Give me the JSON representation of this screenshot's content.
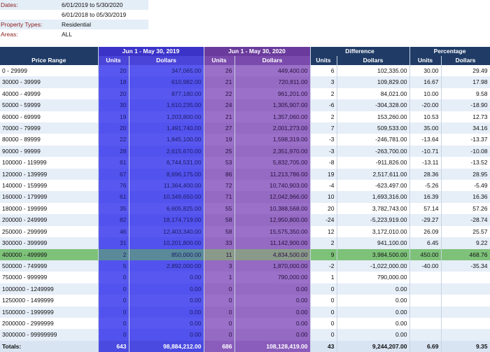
{
  "filters": [
    {
      "label": "Dates:",
      "value": "6/01/2019 to 5/30/2020"
    },
    {
      "label": "",
      "value": "6/01/2018 to 05/30/2019"
    },
    {
      "label": "Property Types:",
      "value": "Residential"
    },
    {
      "label": "Areas:",
      "value": "ALL"
    }
  ],
  "header": {
    "period1": "Jun 1 - May 30, 2019",
    "period2": "Jun 1 - May 30, 2020",
    "difference": "Difference",
    "percentage": "Percentage",
    "price_range": "Price Range",
    "units": "Units",
    "dollars": "Dollars"
  },
  "rows": [
    [
      "0 - 29999",
      "20",
      "347,065.00",
      "26",
      "449,400.00",
      "6",
      "102,335.00",
      "30.00",
      "29.49"
    ],
    [
      "30000 - 39999",
      "18",
      "610,982.00",
      "21",
      "720,811.00",
      "3",
      "109,829.00",
      "16.67",
      "17.98"
    ],
    [
      "40000 - 49999",
      "20",
      "877,180.00",
      "22",
      "961,201.00",
      "2",
      "84,021.00",
      "10.00",
      "9.58"
    ],
    [
      "50000 - 59999",
      "30",
      "1,610,235.00",
      "24",
      "1,305,907.00",
      "-6",
      "-304,328.00",
      "-20.00",
      "-18.90"
    ],
    [
      "60000 - 69999",
      "19",
      "1,203,800.00",
      "21",
      "1,357,060.00",
      "2",
      "153,260.00",
      "10.53",
      "12.73"
    ],
    [
      "70000 - 79999",
      "20",
      "1,491,740.00",
      "27",
      "2,001,273.00",
      "7",
      "509,533.00",
      "35.00",
      "34.16"
    ],
    [
      "80000 - 89999",
      "22",
      "1,845,100.00",
      "19",
      "1,598,319.00",
      "-3",
      "-246,781.00",
      "-13.64",
      "-13.37"
    ],
    [
      "90000 - 99999",
      "28",
      "2,615,670.00",
      "25",
      "2,351,970.00",
      "-3",
      "-263,700.00",
      "-10.71",
      "-10.08"
    ],
    [
      "100000 - 119999",
      "61",
      "6,744,531.00",
      "53",
      "5,832,705.00",
      "-8",
      "-911,826.00",
      "-13.11",
      "-13.52"
    ],
    [
      "120000 - 139999",
      "67",
      "8,696,175.00",
      "86",
      "11,213,786.00",
      "19",
      "2,517,611.00",
      "28.36",
      "28.95"
    ],
    [
      "140000 - 159999",
      "76",
      "11,364,400.00",
      "72",
      "10,740,903.00",
      "-4",
      "-623,497.00",
      "-5.26",
      "-5.49"
    ],
    [
      "160000 - 179999",
      "61",
      "10,349,650.00",
      "71",
      "12,042,966.00",
      "10",
      "1,693,316.00",
      "16.39",
      "16.36"
    ],
    [
      "180000 - 199999",
      "35",
      "6,605,825.00",
      "55",
      "10,388,568.00",
      "20",
      "3,782,743.00",
      "57.14",
      "57.26"
    ],
    [
      "200000 - 249999",
      "82",
      "18,174,719.00",
      "58",
      "12,950,800.00",
      "-24",
      "-5,223,919.00",
      "-29.27",
      "-28.74"
    ],
    [
      "250000 - 299999",
      "46",
      "12,403,340.00",
      "58",
      "15,575,350.00",
      "12",
      "3,172,010.00",
      "26.09",
      "25.57"
    ],
    [
      "300000 - 399999",
      "31",
      "10,201,800.00",
      "33",
      "11,142,900.00",
      "2",
      "941,100.00",
      "6.45",
      "9.22"
    ],
    [
      "400000 - 499999",
      "2",
      "850,000.00",
      "11",
      "4,834,500.00",
      "9",
      "3,984,500.00",
      "450.00",
      "468.76"
    ],
    [
      "500000 - 749999",
      "5",
      "2,892,000.00",
      "3",
      "1,870,000.00",
      "-2",
      "-1,022,000.00",
      "-40.00",
      "-35.34"
    ],
    [
      "750000 - 999999",
      "0",
      "0.00",
      "1",
      "790,000.00",
      "1",
      "790,000.00",
      "",
      ""
    ],
    [
      "1000000 - 1249999",
      "0",
      "0.00",
      "0",
      "0.00",
      "0",
      "0.00",
      "",
      ""
    ],
    [
      "1250000 - 1499999",
      "0",
      "0.00",
      "0",
      "0.00",
      "0",
      "0.00",
      "",
      ""
    ],
    [
      "1500000 - 1999999",
      "0",
      "0.00",
      "0",
      "0.00",
      "0",
      "0.00",
      "",
      ""
    ],
    [
      "2000000 - 2999999",
      "0",
      "0.00",
      "0",
      "0.00",
      "0",
      "0.00",
      "",
      ""
    ],
    [
      "3000000 - 99999999",
      "0",
      "0.00",
      "0",
      "0.00",
      "0",
      "0.00",
      "",
      ""
    ]
  ],
  "highlight_row": "400000 - 499999",
  "totals": [
    "Totals:",
    "643",
    "98,884,212.00",
    "686",
    "108,128,419.00",
    "43",
    "9,244,207.00",
    "6.69",
    "9.35"
  ],
  "colors": {
    "header": "#1f3b66",
    "period1": "#5858f0",
    "period2": "#9a70c8",
    "highlight": "#7ec27a",
    "label": "#8b1c1c"
  }
}
